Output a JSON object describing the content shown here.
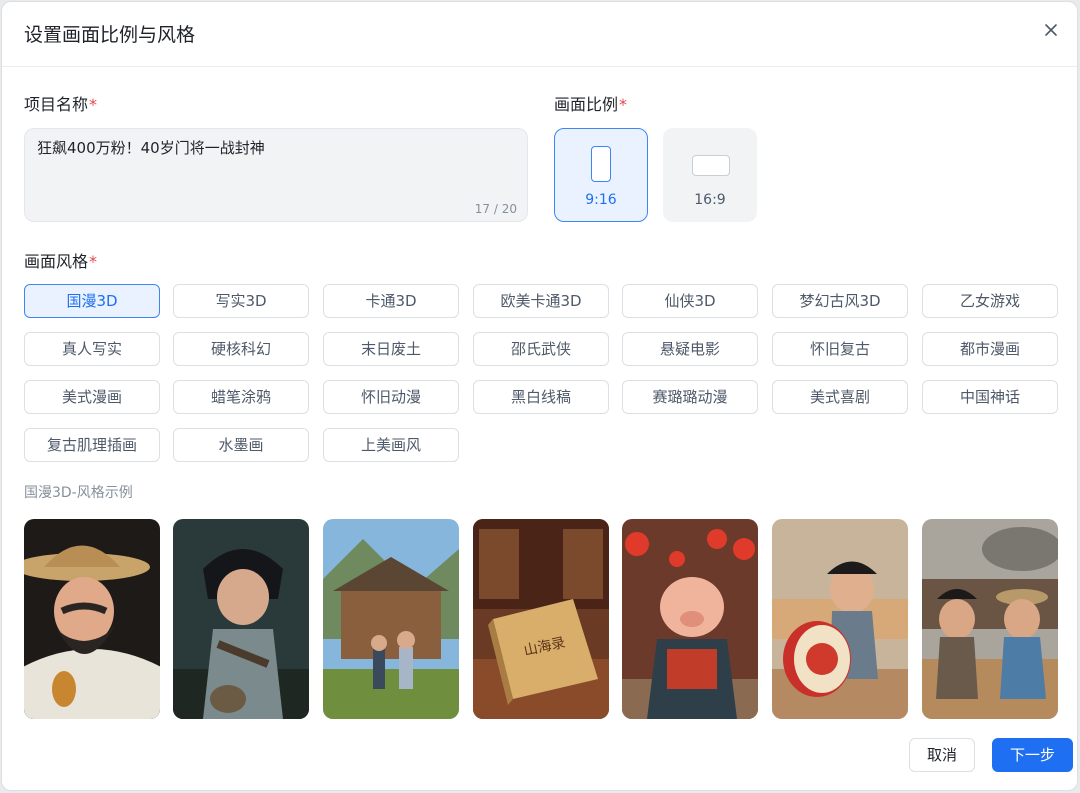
{
  "dialog": {
    "title": "设置画面比例与风格",
    "close_icon": "close-icon"
  },
  "project_name": {
    "label": "项目名称",
    "required_mark": "*",
    "value": "狂飙400万粉！40岁门将一战封神",
    "counter": "17 / 20"
  },
  "aspect_ratio": {
    "label": "画面比例",
    "required_mark": "*",
    "options": [
      {
        "label": "9:16",
        "selected": true,
        "icon": "portrait-rect-icon"
      },
      {
        "label": "16:9",
        "selected": false,
        "icon": "landscape-rect-icon"
      }
    ]
  },
  "style": {
    "label": "画面风格",
    "required_mark": "*",
    "selected": "国漫3D",
    "options": [
      "国漫3D",
      "写实3D",
      "卡通3D",
      "欧美卡通3D",
      "仙侠3D",
      "梦幻古风3D",
      "乙女游戏",
      "真人写实",
      "硬核科幻",
      "末日废土",
      "邵氏武侠",
      "悬疑电影",
      "怀旧复古",
      "都市漫画",
      "美式漫画",
      "蜡笔涂鸦",
      "怀旧动漫",
      "黑白线稿",
      "赛璐璐动漫",
      "美式喜剧",
      "中国神话",
      "复古肌理插画",
      "水墨画",
      "上美画风"
    ]
  },
  "examples": {
    "caption": "国漫3D-风格示例",
    "book_text": "山海录",
    "thumbnails": [
      {
        "subject": "bearded-man-straw-hat"
      },
      {
        "subject": "boy-warrior-dark-forest"
      },
      {
        "subject": "wooden-house-village"
      },
      {
        "subject": "ancient-book-shanhailu"
      },
      {
        "subject": "pig-character-lanterns"
      },
      {
        "subject": "boy-with-red-drum"
      },
      {
        "subject": "battlefield-characters"
      }
    ]
  },
  "footer": {
    "cancel_label": "取消",
    "next_label": "下一步"
  },
  "colors": {
    "accent": "#1e6ff1",
    "selected_bg": "#eaf2ff",
    "required": "#e5484d"
  }
}
